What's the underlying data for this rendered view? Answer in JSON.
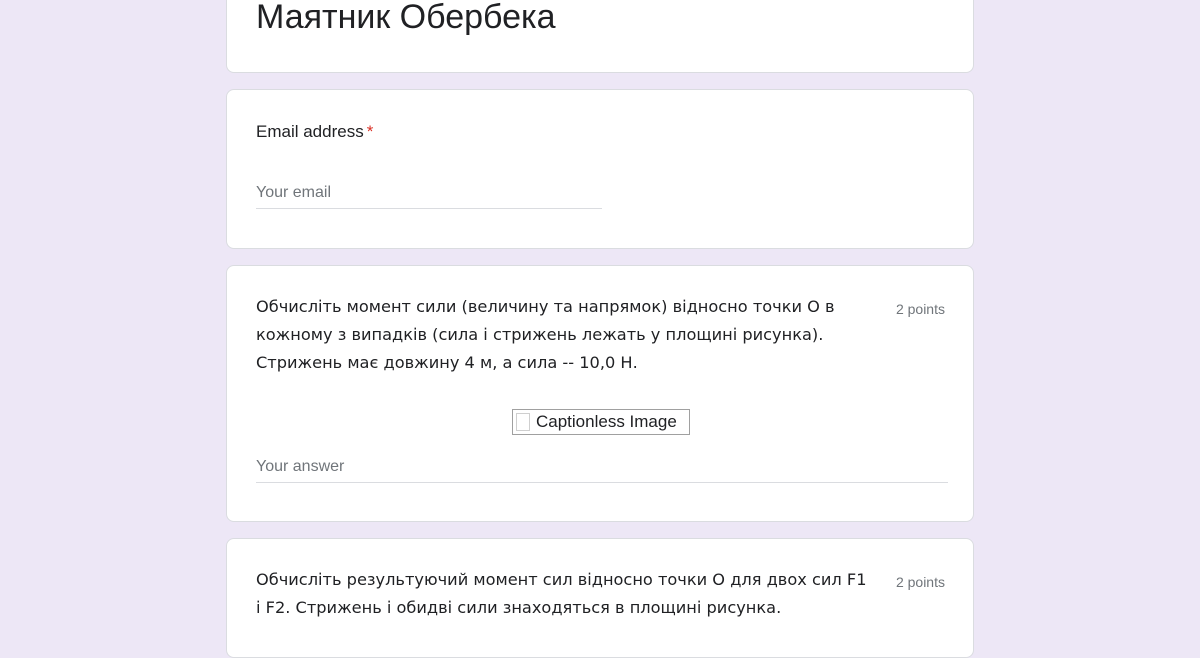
{
  "form": {
    "title": "Маятник Обербека"
  },
  "email": {
    "label": "Email address",
    "required_mark": "*",
    "placeholder": "Your email"
  },
  "questions": [
    {
      "text": "Обчисліть момент сили (величину та напрямок) відносно точки О в кожному з випадків (сила і стрижень лежать у площині рисунка). Стрижень має довжину 4 м, а сила -- 10,0 Н.",
      "points": "2 points",
      "image_alt": "Captionless Image",
      "answer_placeholder": "Your answer"
    },
    {
      "text": "Обчисліть результуючий момент сил відносно точки О для двох сил F1 і F2. Стрижень і обидві сили знаходяться в площині рисунка.",
      "points": "2 points"
    }
  ],
  "colors": {
    "background": "#ede7f6",
    "card": "#ffffff",
    "required": "#d93025",
    "muted_text": "#70757a"
  }
}
